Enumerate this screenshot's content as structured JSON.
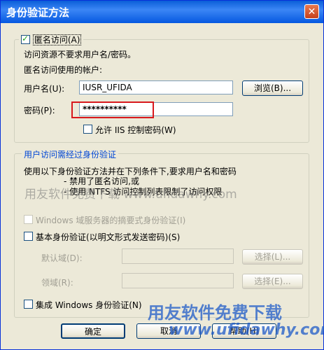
{
  "title": "身份验证方法",
  "close_glyph": "✕",
  "anonymous": {
    "checkbox_label": "匿名访问(A)",
    "checked": true,
    "desc1": "访问资源不要求用户名/密码。",
    "desc2": "匿名访问使用的帐户:",
    "username_label": "用户名(U):",
    "username_value": "IUSR_UFIDA",
    "browse_label": "浏览(B)...",
    "password_label": "密码(P):",
    "password_value": "**********",
    "iis_checkbox_label": "允许 IIS 控制密码(W)",
    "iis_checked": false
  },
  "auth": {
    "group_title": "用户访问需经过身份验证",
    "desc1": "使用以下身份验证方法并在下列条件下,要求用户名和密码",
    "bullet1": "- 禁用了匿名访问,或",
    "bullet2": "- 使用 NTFS 访问控制列表限制了访问权限",
    "digest_label": "Windows 域服务器的摘要式身份验证(I)",
    "basic_label": "基本身份验证(以明文形式发送密码)(S)",
    "default_domain_label": "默认域(D):",
    "default_domain_value": "",
    "select1_label": "选择(L)...",
    "realm_label": "领域(R):",
    "realm_value": "",
    "select2_label": "选择(E)...",
    "integrated_label": "集成 Windows 身份验证(N)"
  },
  "buttons": {
    "ok": "确定",
    "cancel": "取消",
    "help": "帮助(H)"
  },
  "watermark": {
    "text1": "用友软件免费下载 www.ufidawhy.com",
    "text2": "用友软件免费下载",
    "text3": "www.ufidawhy.com"
  }
}
